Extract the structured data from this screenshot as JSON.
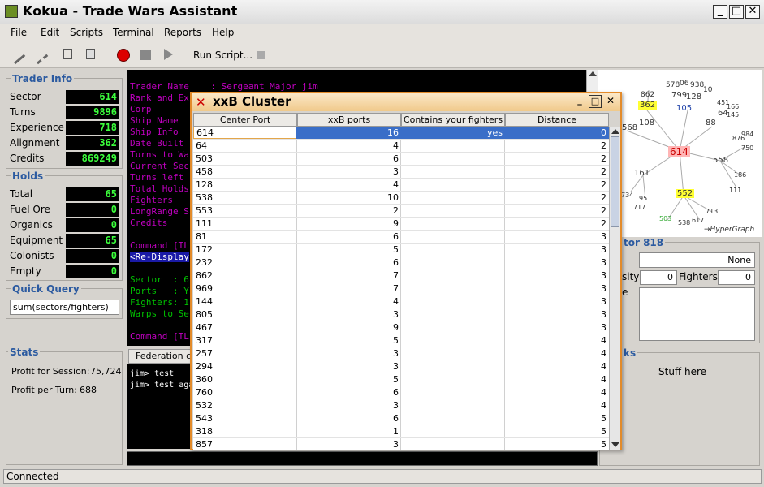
{
  "window": {
    "title": "Kokua - Trade Wars Assistant"
  },
  "menu": [
    "File",
    "Edit",
    "Scripts",
    "Terminal",
    "Reports",
    "Help"
  ],
  "toolbar": {
    "run_script": "Run Script..."
  },
  "trader": {
    "title": "Trader Info",
    "rows": [
      {
        "label": "Sector",
        "value": "614"
      },
      {
        "label": "Turns",
        "value": "9896"
      },
      {
        "label": "Experience",
        "value": "718"
      },
      {
        "label": "Alignment",
        "value": "362"
      },
      {
        "label": "Credits",
        "value": "869249"
      }
    ]
  },
  "holds": {
    "title": "Holds",
    "rows": [
      {
        "label": "Total",
        "value": "65"
      },
      {
        "label": "Fuel Ore",
        "value": "0"
      },
      {
        "label": "Organics",
        "value": "0"
      },
      {
        "label": "Equipment",
        "value": "65"
      },
      {
        "label": "Colonists",
        "value": "0"
      },
      {
        "label": "Empty",
        "value": "0"
      }
    ]
  },
  "quick_query": {
    "title": "Quick Query",
    "value": "sum(sectors/fighters)"
  },
  "stats": {
    "title": "Stats",
    "profit_session_label": "Profit for Session:",
    "profit_session": "75,724",
    "profit_turn_label": "Profit per Turn:",
    "profit_turn": "688"
  },
  "terminal": {
    "lines": [
      {
        "t": "Trader Name    : Sergeant Major jim",
        "c": "#c000c0"
      },
      {
        "t": "Rank and Ex",
        "c": "#c000c0"
      },
      {
        "t": "Corp",
        "c": "#c000c0"
      },
      {
        "t": "Ship Name",
        "c": "#c000c0"
      },
      {
        "t": "Ship Info",
        "c": "#c000c0"
      },
      {
        "t": "Date Built",
        "c": "#c000c0"
      },
      {
        "t": "Turns to Wa",
        "c": "#c000c0"
      },
      {
        "t": "Current Sec",
        "c": "#c000c0"
      },
      {
        "t": "Turns left",
        "c": "#c000c0"
      },
      {
        "t": "Total Holds",
        "c": "#c000c0"
      },
      {
        "t": "Fighters",
        "c": "#c000c0"
      },
      {
        "t": "LongRange S",
        "c": "#c000c0"
      },
      {
        "t": "Credits",
        "c": "#c000c0"
      },
      {
        "t": "",
        "c": "#c000c0"
      },
      {
        "t": "Command [TL",
        "c": "#c000c0"
      },
      {
        "t": "<Re-Display",
        "c": "#ffffff"
      },
      {
        "t": "",
        "c": "#c000c0"
      },
      {
        "t": "Sector  : 6",
        "c": "#00c000"
      },
      {
        "t": "Ports   : Y",
        "c": "#00c000"
      },
      {
        "t": "Fighters: 1",
        "c": "#00c000"
      },
      {
        "t": "Warps to Se",
        "c": "#00c000"
      },
      {
        "t": "",
        "c": "#c000c0"
      },
      {
        "t": "Command [TL",
        "c": "#c000c0"
      }
    ]
  },
  "fed": {
    "tab": "Federation c",
    "lines": [
      "jim> test",
      "jim> test agai"
    ]
  },
  "cluster": {
    "title": "xxB Cluster",
    "headers": [
      "Center Port",
      "xxB ports",
      "Contains your fighters",
      "Distance"
    ],
    "rows": [
      [
        "614",
        "16",
        "yes",
        "0"
      ],
      [
        "64",
        "4",
        "",
        "2"
      ],
      [
        "503",
        "6",
        "",
        "2"
      ],
      [
        "458",
        "3",
        "",
        "2"
      ],
      [
        "128",
        "4",
        "",
        "2"
      ],
      [
        "538",
        "10",
        "",
        "2"
      ],
      [
        "553",
        "2",
        "",
        "2"
      ],
      [
        "111",
        "9",
        "",
        "2"
      ],
      [
        "81",
        "6",
        "",
        "3"
      ],
      [
        "172",
        "5",
        "",
        "3"
      ],
      [
        "232",
        "6",
        "",
        "3"
      ],
      [
        "862",
        "7",
        "",
        "3"
      ],
      [
        "969",
        "7",
        "",
        "3"
      ],
      [
        "144",
        "4",
        "",
        "3"
      ],
      [
        "805",
        "3",
        "",
        "3"
      ],
      [
        "467",
        "9",
        "",
        "3"
      ],
      [
        "317",
        "5",
        "",
        "4"
      ],
      [
        "257",
        "3",
        "",
        "4"
      ],
      [
        "294",
        "3",
        "",
        "4"
      ],
      [
        "360",
        "5",
        "",
        "4"
      ],
      [
        "760",
        "6",
        "",
        "4"
      ],
      [
        "532",
        "3",
        "",
        "4"
      ],
      [
        "543",
        "6",
        "",
        "5"
      ],
      [
        "318",
        "1",
        "",
        "5"
      ],
      [
        "857",
        "3",
        "",
        "5"
      ]
    ]
  },
  "sector": {
    "title": "tor 818",
    "none": "None",
    "sity": "sity",
    "density": "0",
    "fighters_label": "Fighters",
    "fighters": "0",
    "e": "e"
  },
  "notes": {
    "title": "ks",
    "text": "Stuff here"
  },
  "graph": {
    "label": "→HyperGraph",
    "nodes": [
      "862",
      "578",
      "06",
      "938",
      "10",
      "799",
      "128",
      "362",
      "105",
      "568",
      "108",
      "88",
      "451",
      "166",
      "64",
      "145",
      "614",
      "876",
      "984",
      "750",
      "558",
      "186",
      "161",
      "111",
      "734",
      "95",
      "717",
      "552",
      "713",
      "503",
      "538",
      "617"
    ]
  },
  "status": "Connected"
}
